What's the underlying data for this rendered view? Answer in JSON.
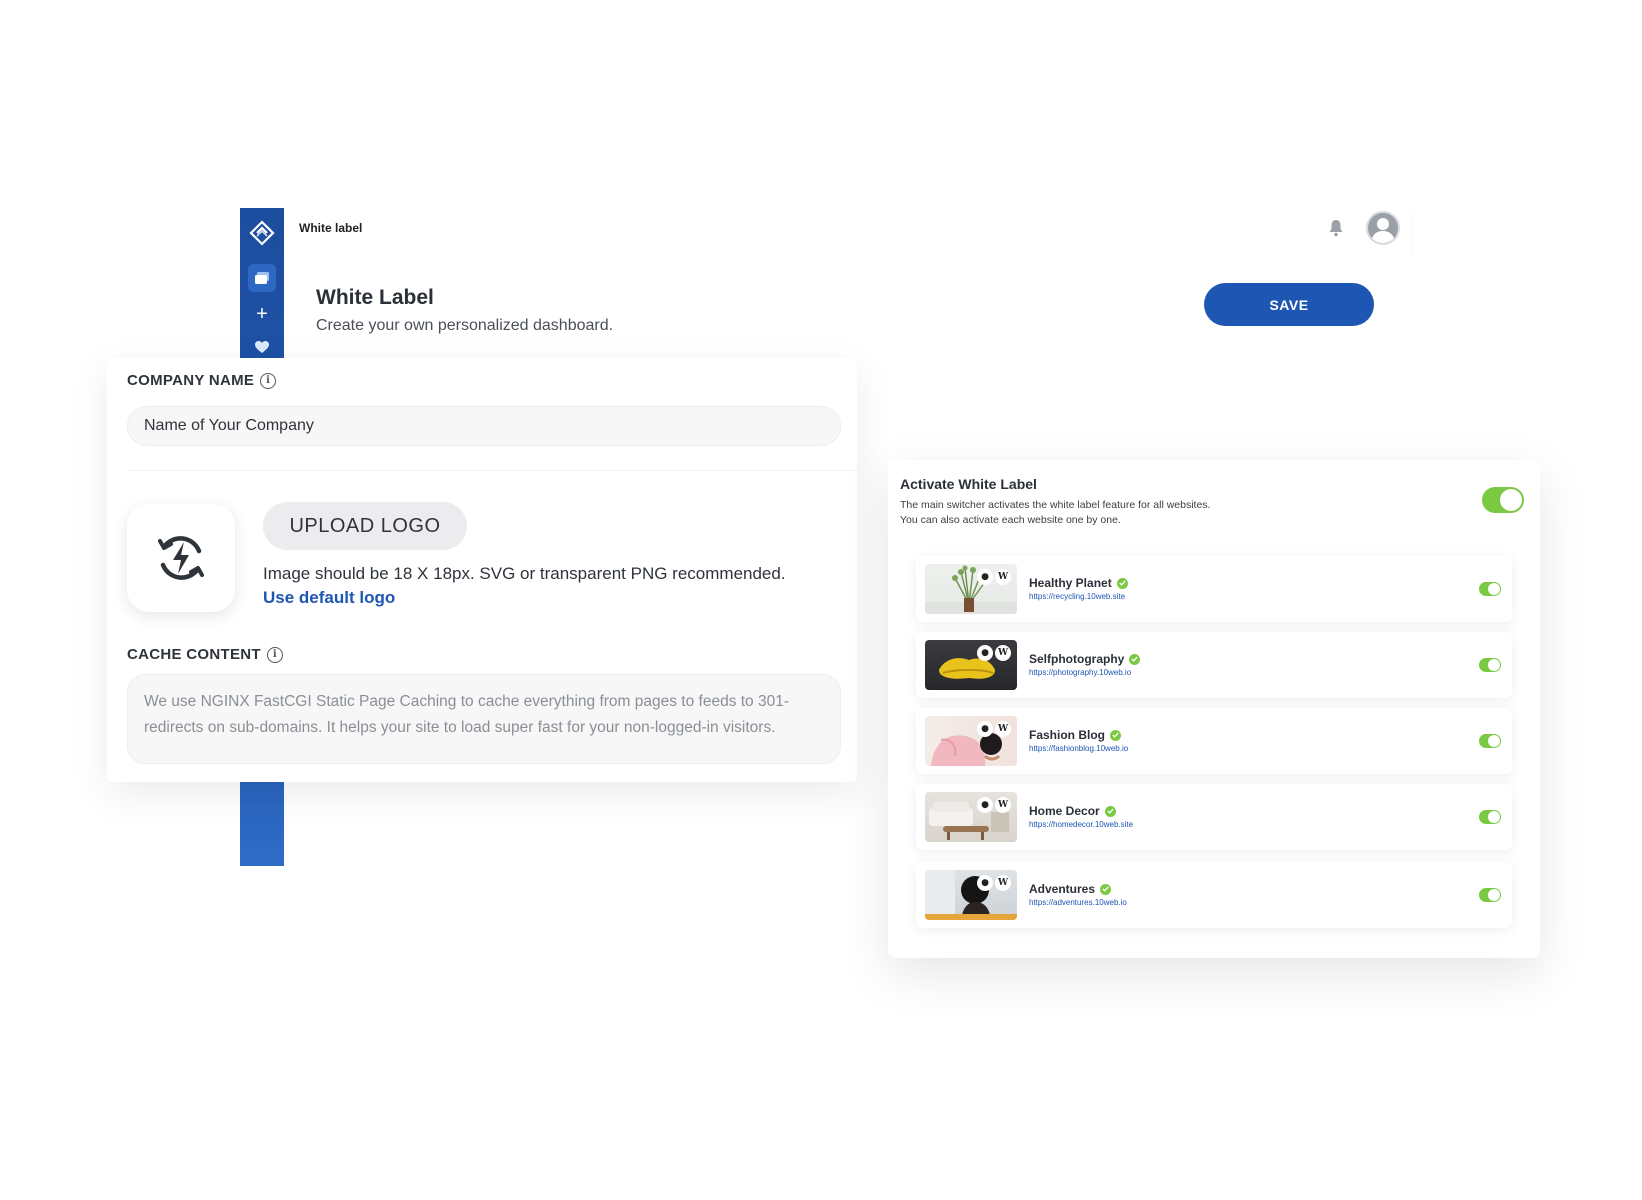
{
  "topbar": {
    "title": "White label",
    "bell_icon": "bell-icon",
    "avatar_icon": "user-avatar-icon"
  },
  "sidebar": {
    "logo_icon": "brand-logo-icon",
    "items": [
      {
        "icon": "websites-icon"
      },
      {
        "icon": "plus-icon"
      },
      {
        "icon": "heart-icon"
      }
    ]
  },
  "header": {
    "title": "White Label",
    "subtitle": "Create your own personalized dashboard.",
    "save_label": "SAVE"
  },
  "company": {
    "label": "COMPANY NAME",
    "value": "Name of Your Company"
  },
  "logo": {
    "icon": "lightning-refresh-icon",
    "upload_label": "UPLOAD LOGO",
    "hint": "Image should be 18 X 18px. SVG or transparent PNG recommended.",
    "default_link": "Use default logo"
  },
  "cache": {
    "label": "CACHE CONTENT",
    "text": "We use NGINX FastCGI Static Page Caching to cache everything from pages to feeds to 301-redirects on sub-domains. It helps your site to load super fast for your non-logged-in visitors."
  },
  "activate": {
    "title": "Activate White Label",
    "desc_line1": "The main switcher activates the white label feature for all websites.",
    "desc_line2": "You can also activate each website one by one.",
    "enabled": true
  },
  "sites": [
    {
      "name": "Healthy Planet",
      "url": "https://recycling.10web.site",
      "enabled": true
    },
    {
      "name": "Selfphotography",
      "url": "https://photography.10web.io",
      "enabled": true
    },
    {
      "name": "Fashion Blog",
      "url": "https://fashionblog.10web.io",
      "enabled": true
    },
    {
      "name": "Home Decor",
      "url": "https://homedecor.10web.site",
      "enabled": true
    },
    {
      "name": "Adventures",
      "url": "https://adventures.10web.io",
      "enabled": true
    }
  ],
  "colors": {
    "primary": "#1e56b3",
    "toggle_on": "#7ac943",
    "sidebar": "#1d4d9f"
  }
}
